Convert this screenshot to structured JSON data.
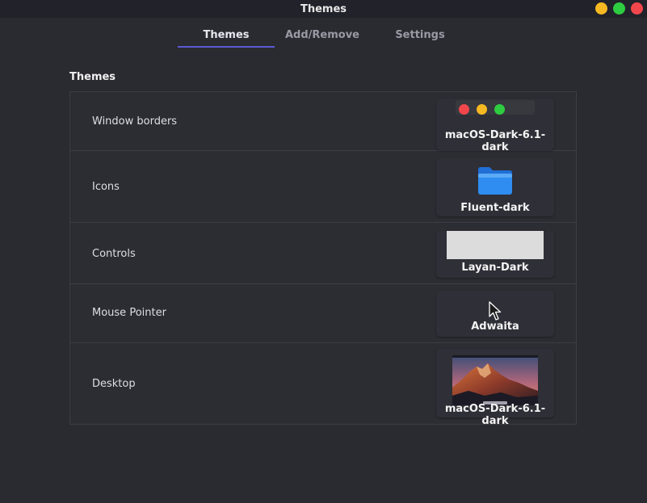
{
  "window": {
    "title": "Themes",
    "controls": [
      "minimize",
      "maximize",
      "close"
    ],
    "colors": {
      "minimize": "#f6b921",
      "maximize": "#2ecc40",
      "close": "#f1474c"
    }
  },
  "tabs": [
    {
      "label": "Themes",
      "active": true
    },
    {
      "label": "Add/Remove",
      "active": false
    },
    {
      "label": "Settings",
      "active": false
    }
  ],
  "accent_color": "#5b5bd6",
  "section": {
    "title": "Themes"
  },
  "rows": [
    {
      "label": "Window borders",
      "value": "macOS-Dark-6.1-dark",
      "preview": "traffic-light-buttons"
    },
    {
      "label": "Icons",
      "value": "Fluent-dark",
      "preview": "folder-icon"
    },
    {
      "label": "Controls",
      "value": "Layan-Dark",
      "preview": "controls-swatch"
    },
    {
      "label": "Mouse Pointer",
      "value": "Adwaita",
      "preview": "arrow-pointer-icon"
    },
    {
      "label": "Desktop",
      "value": "macOS-Dark-6.1-dark",
      "preview": "mountain-wallpaper"
    }
  ]
}
